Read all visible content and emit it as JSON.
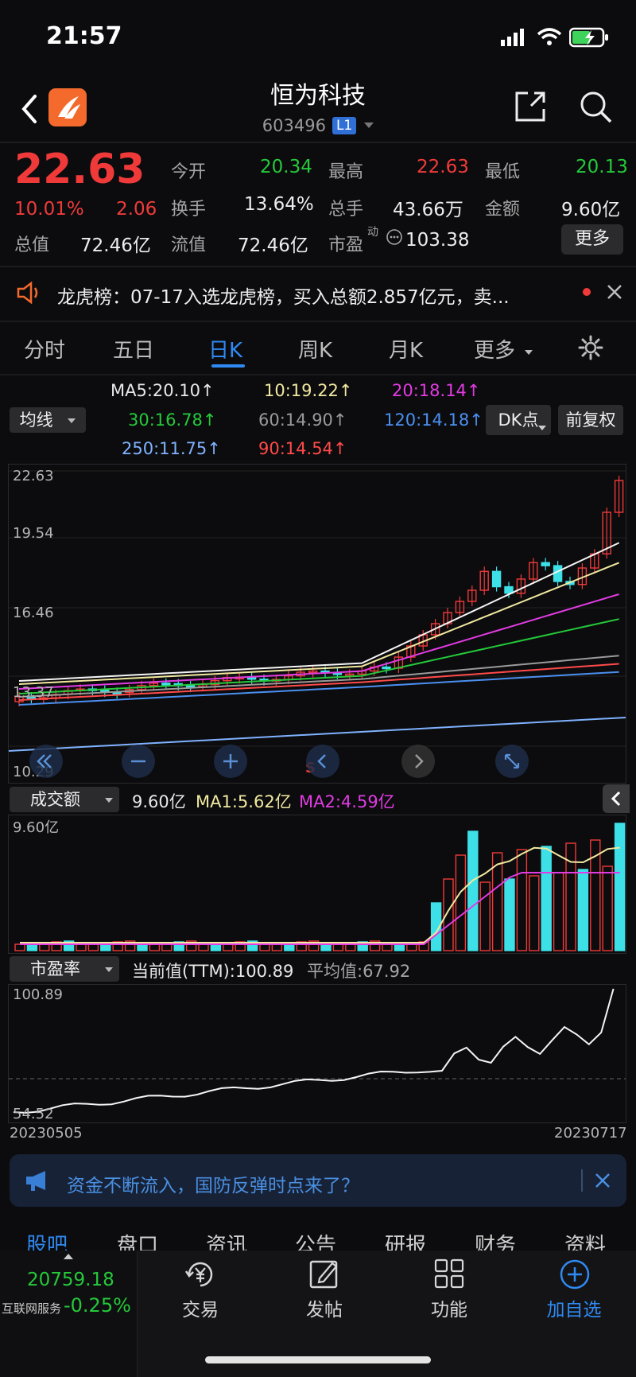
{
  "status_bar": {
    "time": "21:57"
  },
  "header": {
    "title": "恒为科技",
    "code": "603496",
    "level_badge": "L1"
  },
  "quote": {
    "price": "22.63",
    "change_pct": "10.01%",
    "change_abs": "2.06",
    "open_label": "今开",
    "open": "20.34",
    "high_label": "最高",
    "high": "22.63",
    "low_label": "最低",
    "low": "20.13",
    "turnover_label": "换手",
    "turnover": "13.64%",
    "volume_label": "总手",
    "volume": "43.66万",
    "amount_label": "金额",
    "amount": "9.60亿",
    "mktcap_label": "总值",
    "mktcap": "72.46亿",
    "float_label": "流值",
    "float": "72.46亿",
    "pe_label": "市盈",
    "pe_super": "动",
    "pe": "103.38",
    "more_label": "更多"
  },
  "news": {
    "text": "龙虎榜：07-17入选龙虎榜，买入总额2.857亿元，卖..."
  },
  "tabs": [
    "分时",
    "五日",
    "日K",
    "周K",
    "月K",
    "更多"
  ],
  "active_tab": "日K",
  "ma": {
    "selector": "均线",
    "ma5": "MA5:20.10",
    "ma10": "10:19.22",
    "ma20": "20:18.14",
    "ma30": "30:16.78",
    "ma60": "60:14.90",
    "ma120": "120:14.18",
    "ma250": "250:11.75",
    "ma90": "90:14.54",
    "arrow": "↑",
    "dk_button": "DK点",
    "adjust_button": "前复权"
  },
  "kline": {
    "y_labels": [
      "22.63",
      "19.54",
      "16.46",
      "13.37",
      "10.29"
    ],
    "s_marker": "S"
  },
  "volume": {
    "selector": "成交额",
    "current": "9.60亿",
    "ma1": "MA1:5.62亿",
    "ma2": "MA2:4.59亿",
    "y_top": "9.60亿"
  },
  "pe_panel": {
    "selector": "市盈率",
    "current": "当前值(TTM):100.89",
    "average": "平均值:67.92",
    "y_top": "100.89",
    "y_bottom": "54.52",
    "x_start": "20230505",
    "x_end": "20230717"
  },
  "ad": {
    "text": "资金不断流入，国防反弹时点来了？"
  },
  "sub_tabs": [
    "股吧",
    "盘口",
    "资讯",
    "公告",
    "研报",
    "财务",
    "资料"
  ],
  "bottom_nav": {
    "index_value": "20759.18",
    "index_name": "互联网服务",
    "index_change": "-0.25%",
    "items": [
      "交易",
      "发帖",
      "功能",
      "加自选"
    ]
  },
  "colors": {
    "up": "#f03a3a",
    "down": "#25c93a",
    "accent": "#2f8af3",
    "bg": "#0c0c0e",
    "volume_down": "#3ee0e8"
  }
}
